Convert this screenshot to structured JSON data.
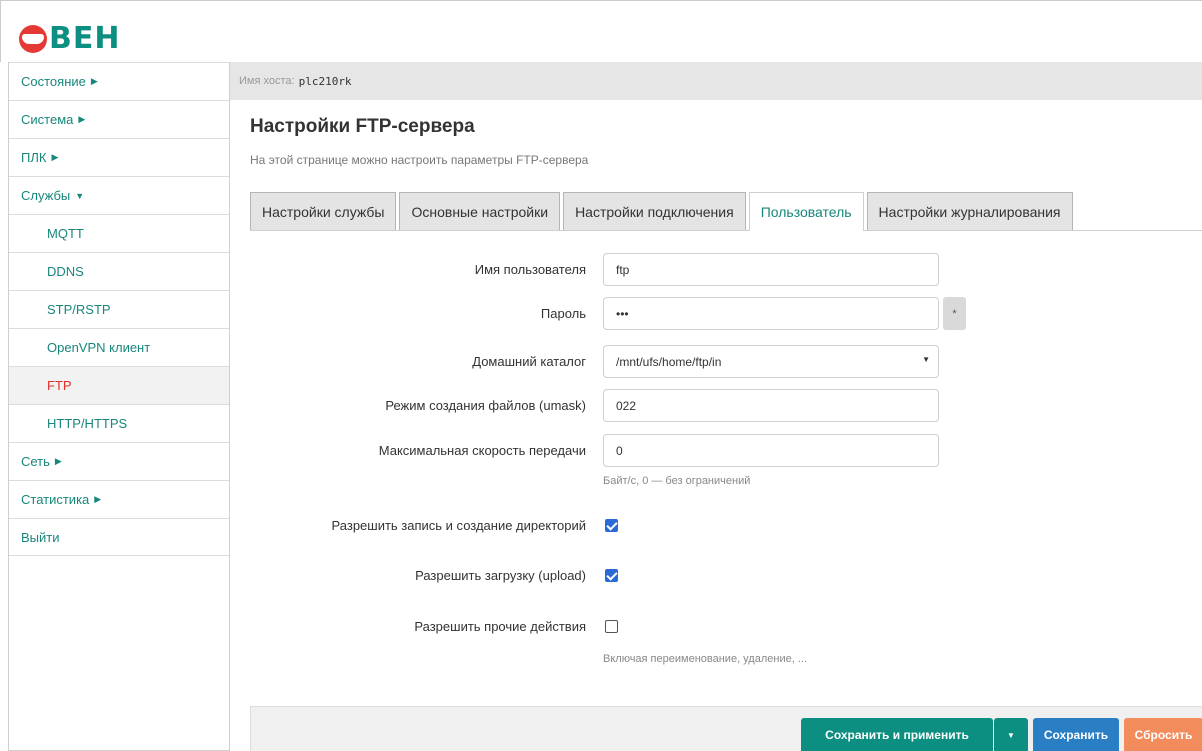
{
  "brand": {
    "logo_text": "ВЕН"
  },
  "sidebar": {
    "items": [
      {
        "label": "Состояние",
        "arrow": "▶"
      },
      {
        "label": "Система",
        "arrow": "▶"
      },
      {
        "label": "ПЛК",
        "arrow": "▶"
      },
      {
        "label": "Службы",
        "arrow": "▼"
      },
      {
        "label": "MQTT"
      },
      {
        "label": "DDNS"
      },
      {
        "label": "STP/RSTP"
      },
      {
        "label": "OpenVPN клиент"
      },
      {
        "label": "FTP"
      },
      {
        "label": "HTTP/HTTPS"
      },
      {
        "label": "Сеть",
        "arrow": "▶"
      },
      {
        "label": "Статистика",
        "arrow": "▶"
      },
      {
        "label": "Выйти"
      }
    ]
  },
  "hostbar": {
    "label": "Имя хоста:",
    "value": "plc210rk"
  },
  "page": {
    "title": "Настройки FTP-сервера",
    "description": "На этой странице можно настроить параметры FTP-сервера"
  },
  "tabs": [
    {
      "label": "Настройки службы"
    },
    {
      "label": "Основные настройки"
    },
    {
      "label": "Настройки подключения"
    },
    {
      "label": "Пользователь"
    },
    {
      "label": "Настройки журналирования"
    }
  ],
  "form": {
    "username": {
      "label": "Имя пользователя",
      "value": "ftp"
    },
    "password": {
      "label": "Пароль",
      "value": "•••",
      "reveal": "*"
    },
    "home_dir": {
      "label": "Домашний каталог",
      "value": "/mnt/ufs/home/ftp/in",
      "arrow": "▼"
    },
    "umask": {
      "label": "Режим создания файлов (umask)",
      "value": "022"
    },
    "max_rate": {
      "label": "Максимальная скорость передачи",
      "value": "0",
      "hint": "Байт/с, 0 — без ограничений"
    },
    "allow_write": {
      "label": "Разрешить запись и создание директорий",
      "checked": true
    },
    "allow_upload": {
      "label": "Разрешить загрузку (upload)",
      "checked": true
    },
    "allow_other": {
      "label": "Разрешить прочие действия",
      "checked": false,
      "hint": "Включая переименование, удаление, ..."
    }
  },
  "footer": {
    "apply_label": "Сохранить и применить",
    "apply_split": "▼",
    "save_label": "Сохранить",
    "reset_label": "Сбросить"
  },
  "colors": {
    "accent": "#0c8f80",
    "active_red": "#e0302a",
    "save_blue": "#2a7ec4",
    "reset_orange": "#f28c5c"
  }
}
